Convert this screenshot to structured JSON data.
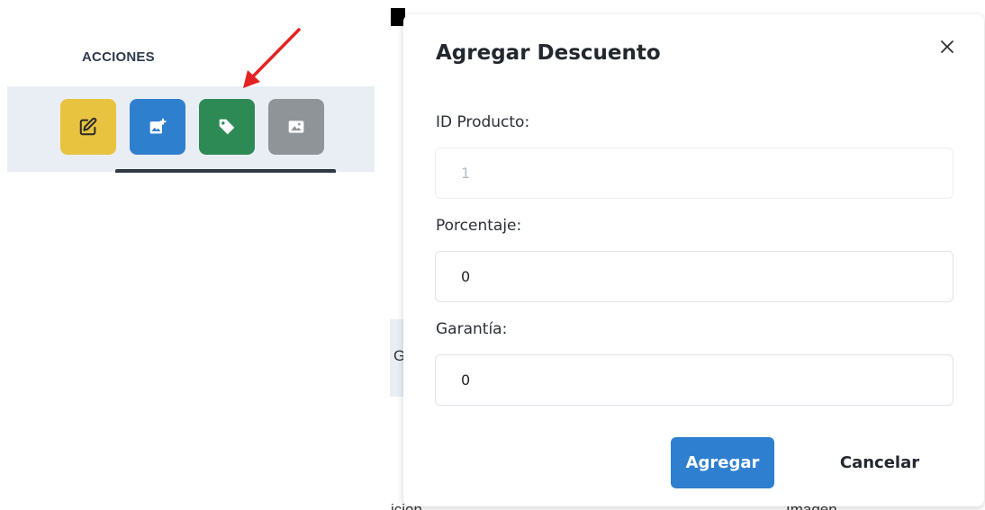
{
  "table": {
    "acciones_header": "ACCIONES",
    "actions": [
      {
        "icon": "edit-icon",
        "color": "#e8c33f"
      },
      {
        "icon": "add-image-icon",
        "color": "#2f7fcf"
      },
      {
        "icon": "tag-icon",
        "color": "#2e8a55"
      },
      {
        "icon": "image-icon",
        "color": "#8f9499"
      }
    ],
    "annotation_arrow_color": "#e52222",
    "background_text": {
      "partial_g": "G",
      "bottom_left": "icion",
      "bottom_right": "Imagen"
    }
  },
  "modal": {
    "title": "Agregar Descuento",
    "fields": {
      "id_producto": {
        "label": "ID Producto:",
        "value": "1"
      },
      "porcentaje": {
        "label": "Porcentaje:",
        "value": "0"
      },
      "garantia": {
        "label": "Garantía:",
        "value": "0"
      }
    },
    "submit_label": "Agregar",
    "cancel_label": "Cancelar",
    "primary_color": "#2f7fd0"
  }
}
